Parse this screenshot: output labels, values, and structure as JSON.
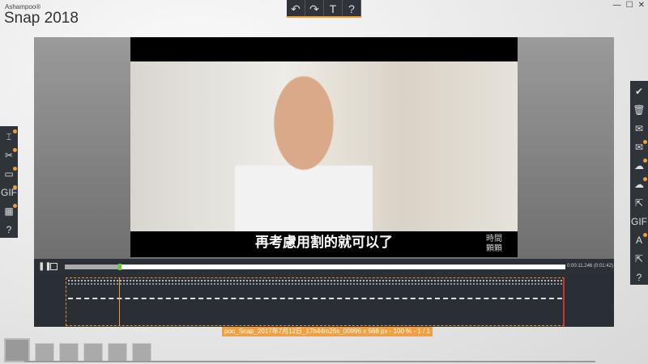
{
  "app": {
    "vendor": "Ashampoo®",
    "title": "Snap 2018"
  },
  "toolbar": {
    "undo": "↶",
    "redo": "↷",
    "text": "T",
    "help": "?"
  },
  "window": {
    "minimize": "—",
    "maximize": "☐",
    "close": "✕"
  },
  "video": {
    "subtitle": "再考慮用割的就可以了",
    "watermark_line1": "時間",
    "watermark_line2": "顆顆"
  },
  "player": {
    "time": "0:00:11.246",
    "duration": "(0:01:42)",
    "progress_percent": 11
  },
  "file": {
    "label": "poo_Snap_2017年7月12日_17h44m26s_00996 x 568 px - 100 % - 1 / 1"
  },
  "left_tools": [
    {
      "name": "crop-icon",
      "glyph": "⌶"
    },
    {
      "name": "cut-icon",
      "glyph": "✂"
    },
    {
      "name": "export-video-icon",
      "glyph": "▭"
    },
    {
      "name": "gif-icon",
      "glyph": "GIF"
    },
    {
      "name": "film-add-icon",
      "glyph": "▦"
    },
    {
      "name": "help-icon",
      "glyph": "?"
    }
  ],
  "right_tools": [
    {
      "name": "save-icon",
      "glyph": "✔"
    },
    {
      "name": "delete-icon",
      "glyph": "🗑"
    },
    {
      "name": "email-icon",
      "glyph": "✉"
    },
    {
      "name": "email-share-icon",
      "glyph": "✉"
    },
    {
      "name": "cloud-upload-icon",
      "glyph": "☁"
    },
    {
      "name": "cloud-icon",
      "glyph": "☁"
    },
    {
      "name": "share-icon",
      "glyph": "⇱"
    },
    {
      "name": "gif-export-icon",
      "glyph": "GIF"
    },
    {
      "name": "text-recognition-icon",
      "glyph": "A"
    },
    {
      "name": "open-with-icon",
      "glyph": "⇱"
    },
    {
      "name": "help-icon",
      "glyph": "?"
    }
  ]
}
